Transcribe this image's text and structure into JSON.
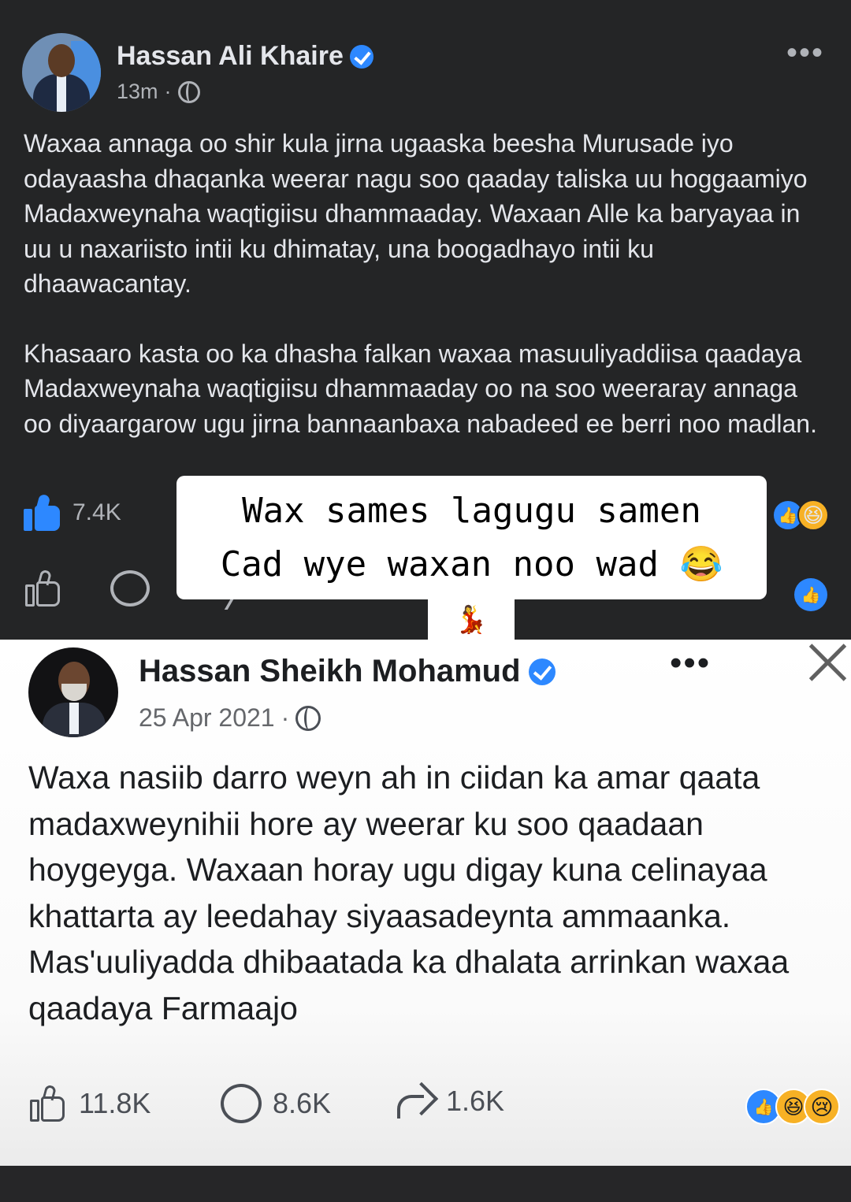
{
  "top_post": {
    "author": "Hassan Ali Khaire",
    "time": "13m",
    "dot": "·",
    "paragraphs": [
      "Waxaa annaga oo shir kula jirna ugaaska beesha Murusade iyo odayaasha dhaqanka weerar nagu soo qaaday taliska uu hoggaamiyo Madaxweynaha waqtigiisu dhammaaday. Waxaan Alle ka baryayaa in uu u naxariisto intii ku dhimatay, una boogadhayo intii ku dhaawacantay.",
      "Khasaaro kasta oo ka dhasha falkan waxaa masuuliyaddiisa qaadaya Madaxweynaha waqtigiisu dhammaaday oo na soo weeraray annaga oo diyaargarow ugu jirna bannaanbaxa nabadeed ee berri noo madlan."
    ],
    "likes": "7.4K",
    "more_icon": "•••",
    "icons": {
      "verified": "verified-badge-icon",
      "privacy": "globe-icon",
      "reactions": [
        "like-reaction-icon",
        "haha-reaction-icon"
      ]
    },
    "accent_color": "#2d88ff",
    "background": "#242526"
  },
  "caption": {
    "line1": "Wax sames lagugu samen",
    "line2": "Cad wye waxan noo wad 😂",
    "tail_emoji": "💃"
  },
  "bottom_post": {
    "author": "Hassan Sheikh Mohamud",
    "time": "25 Apr 2021",
    "dot": "·",
    "text": "Waxa nasiib darro weyn ah in ciidan ka amar qaata madaxweynihii hore ay weerar ku soo qaadaan hoygeyga. Waxaan horay ugu digay kuna celinayaa khattarta ay leedahay siyaasadeynta ammaanka. Mas'uuliyadda dhibaatada ka dhalata arrinkan waxaa qaadaya Farmaajo",
    "likes": "11.8K",
    "comments": "8.6K",
    "shares": "1.6K",
    "more_icon": "•••",
    "icons": {
      "verified": "verified-badge-icon",
      "privacy": "globe-icon",
      "close": "close-icon",
      "reactions": [
        "like-reaction-icon",
        "haha-reaction-icon",
        "sad-reaction-icon"
      ]
    },
    "reaction_glyphs": {
      "like": "👍",
      "haha": "😆",
      "sad": "😢"
    }
  },
  "top_reaction_glyphs": {
    "like": "👍",
    "haha": "😆",
    "messenger_like": "👍"
  }
}
